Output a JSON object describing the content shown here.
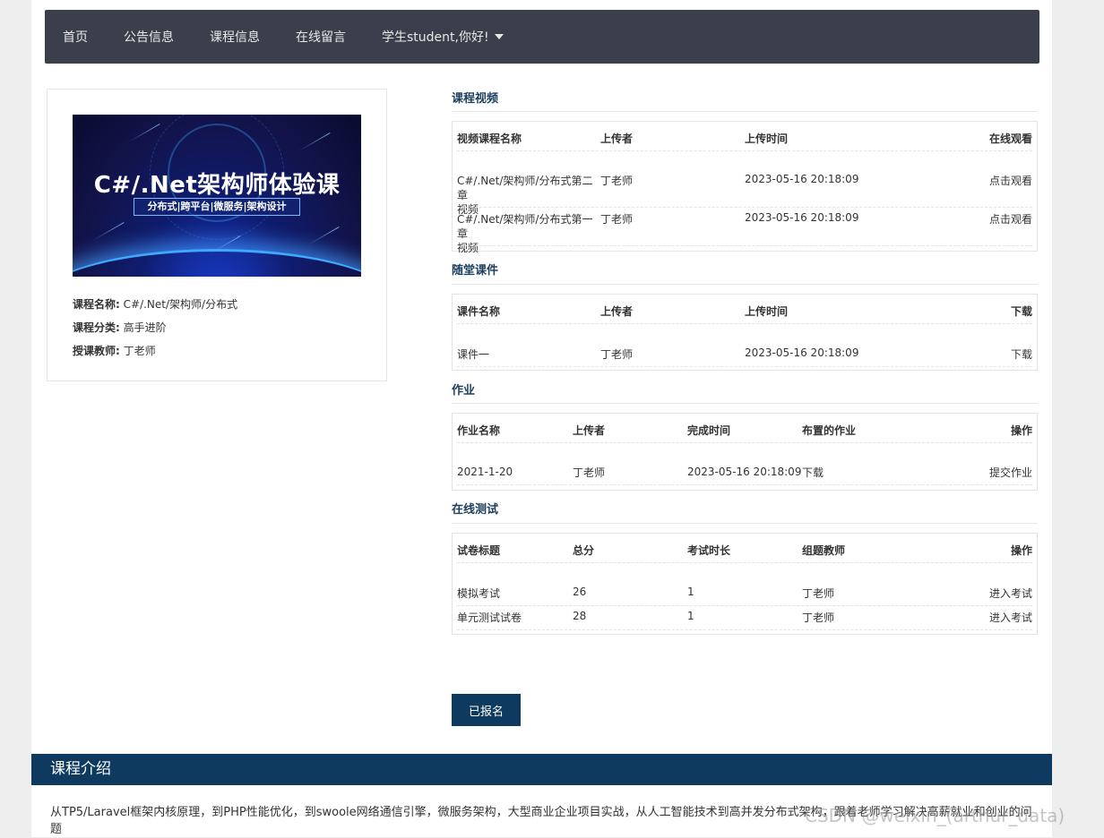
{
  "nav": {
    "items": [
      "首页",
      "公告信息",
      "课程信息",
      "在线留言"
    ],
    "user_menu": "学生student,你好!"
  },
  "course": {
    "banner_title": "C#/.Net架构师体验课",
    "banner_subtitle": "分布式|跨平台|微服务|架构设计",
    "name_label": "课程名称:",
    "name": "C#/.Net/架构师/分布式",
    "category_label": "课程分类:",
    "category": "高手进阶",
    "teacher_label": "授课教师:",
    "teacher": "丁老师"
  },
  "videos": {
    "title": "课程视频",
    "headers": [
      "视频课程名称",
      "上传者",
      "上传时间",
      "在线观看"
    ],
    "rows": [
      {
        "name_l1": "C#/.Net/架构师/分布式第二章",
        "name_l2": "视频",
        "uploader": "丁老师",
        "time": "2023-05-16 20:18:09",
        "action": "点击观看"
      },
      {
        "name_l1": "C#/.Net/架构师/分布式第一章",
        "name_l2": "视频",
        "uploader": "丁老师",
        "time": "2023-05-16 20:18:09",
        "action": "点击观看"
      }
    ]
  },
  "courseware": {
    "title": "随堂课件",
    "headers": [
      "课件名称",
      "上传者",
      "上传时间",
      "下载"
    ],
    "rows": [
      {
        "name": "课件一",
        "uploader": "丁老师",
        "time": "2023-05-16 20:18:09",
        "action": "下载"
      }
    ]
  },
  "homework": {
    "title": "作业",
    "headers": [
      "作业名称",
      "上传者",
      "完成时间",
      "布置的作业",
      "操作"
    ],
    "rows": [
      {
        "name": "2021-1-20",
        "uploader": "丁老师",
        "time": "2023-05-16 20:18:09",
        "assigned": "下载",
        "action": "提交作业"
      }
    ]
  },
  "exams": {
    "title": "在线测试",
    "headers": [
      "试卷标题",
      "总分",
      "考试时长",
      "组题教师",
      "操作"
    ],
    "rows": [
      {
        "title": "模拟考试",
        "score": "26",
        "duration": "1",
        "teacher": "丁老师",
        "action": "进入考试"
      },
      {
        "title": "单元测试试卷",
        "score": "28",
        "duration": "1",
        "teacher": "丁老师",
        "action": "进入考试"
      }
    ]
  },
  "enroll_button": "已报名",
  "intro": {
    "title": "课程介绍",
    "text": "从TP5/Laravel框架内核原理，到PHP性能优化，到swoole网络通信引擎，微服务架构，大型商业企业项目实战，从人工智能技术到高并发分布式架构，跟着老师学习解决高薪就业和创业的问题"
  },
  "watermark": "CSDN @weixin_(arthur_data)",
  "colors": {
    "nav_bg": "#3b3f4b",
    "accent": "#0d3a5e",
    "link": "#f0a030"
  }
}
